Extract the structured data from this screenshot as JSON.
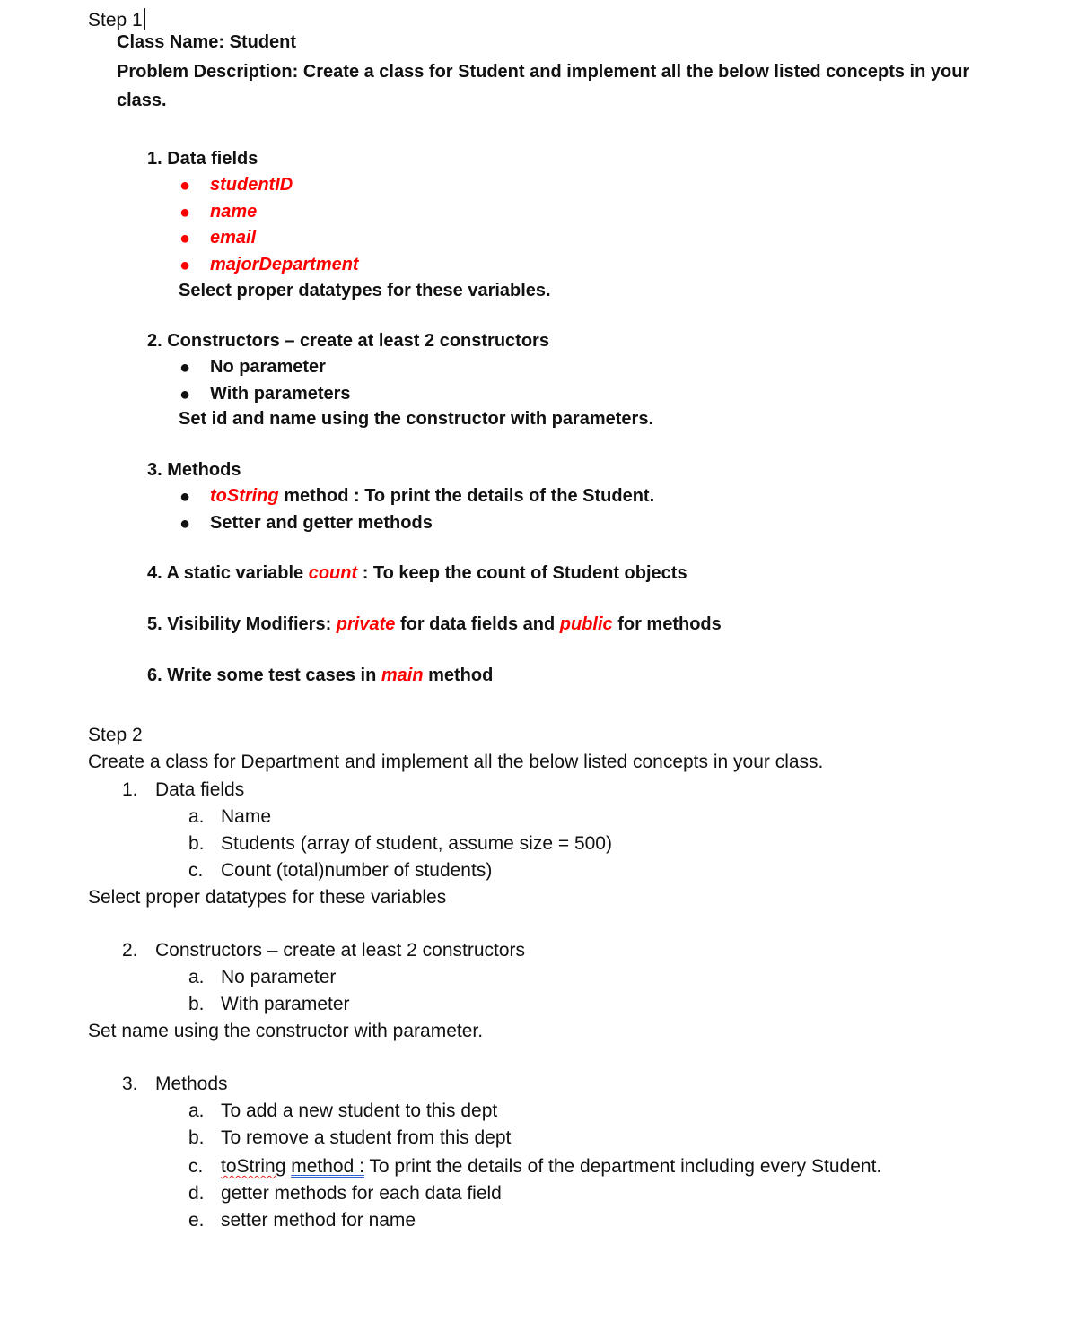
{
  "step1": {
    "heading": "Step 1",
    "class_name": "Class Name: Student",
    "problem_line1": "Problem Description: Create a class for Student and implement all the below listed concepts in your",
    "problem_line2": "class.",
    "section1": {
      "title": "1. Data fields",
      "fields": [
        "studentID",
        "name",
        "email",
        "majorDepartment"
      ],
      "note": "Select proper datatypes for these variables."
    },
    "section2": {
      "title": "2. Constructors – create at least 2 constructors",
      "items": [
        "No parameter",
        "With parameters"
      ],
      "note": "Set id and name using the constructor with parameters."
    },
    "section3": {
      "title": "3. Methods",
      "item1_keyword": "toString",
      "item1_rest": " method : To print the details of the Student.",
      "item2": "Setter and getter methods"
    },
    "section4": {
      "prefix": "4. A static variable ",
      "keyword": "count",
      "suffix": " : To keep the count of Student objects"
    },
    "section5": {
      "prefix": "5. Visibility Modifiers: ",
      "keyword1": "private",
      "middle": " for data fields and ",
      "keyword2": "public",
      "suffix": " for methods"
    },
    "section6": {
      "prefix": "6. Write some test cases in ",
      "keyword": "main",
      "suffix": " method"
    }
  },
  "step2": {
    "heading": "Step 2",
    "intro": "Create a class for Department and implement all the below listed concepts in your class.",
    "section1": {
      "number": "1.",
      "title": "Data fields",
      "items": [
        {
          "marker": "a.",
          "text": "Name"
        },
        {
          "marker": "b.",
          "text": "Students (array of student, assume size = 500)"
        },
        {
          "marker": "c.",
          "text": "Count (total)number of students)"
        }
      ],
      "note": "Select proper datatypes for these variables"
    },
    "section2": {
      "number": "2.",
      "title": "Constructors – create at least 2 constructors",
      "items": [
        {
          "marker": "a.",
          "text": "No parameter"
        },
        {
          "marker": "b.",
          "text": "With parameter"
        }
      ],
      "note": "Set name using the constructor with parameter."
    },
    "section3": {
      "number": "3.",
      "title": "Methods",
      "items": [
        {
          "marker": "a.",
          "text": "To add a new student to this dept"
        },
        {
          "marker": "b.",
          "text": "To remove a student from this dept"
        },
        {
          "marker": "c.",
          "text_spellcheck": "toString",
          "text_grammar": "method :",
          "text_rest": " To print the details of the department including every Student."
        },
        {
          "marker": "d.",
          "text": "getter methods for each data field"
        },
        {
          "marker": "e.",
          "text": "setter method for name"
        }
      ]
    }
  },
  "colors": {
    "text": "#111111",
    "highlight": "#ff0000",
    "spellcheck": "#e02020",
    "grammar": "#2f5fd0"
  }
}
